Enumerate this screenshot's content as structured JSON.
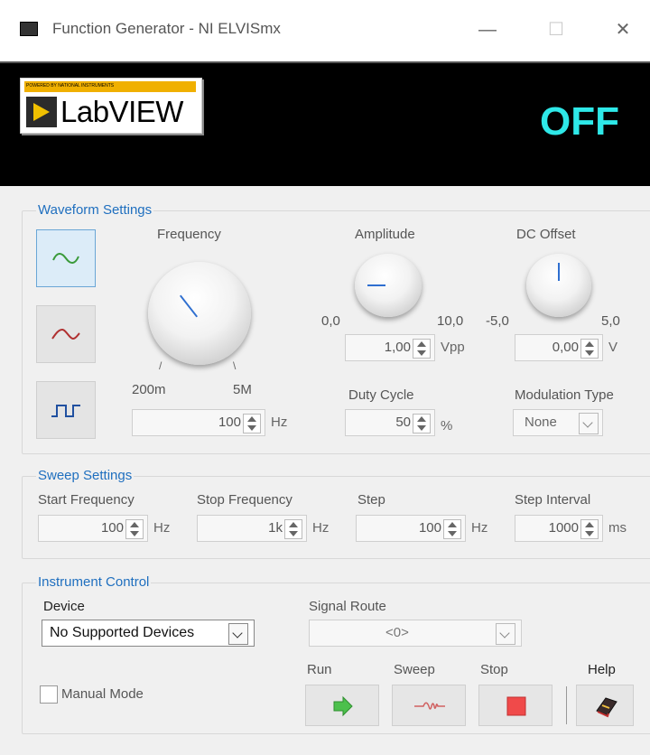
{
  "window": {
    "title": "Function Generator - NI ELVISmx",
    "minimize_glyph": "—",
    "maximize_glyph": "☐",
    "close_glyph": "✕"
  },
  "header": {
    "logo_text": "LabVIEW",
    "logo_strip_text": "POWERED BY NATIONAL INSTRUMENTS",
    "status": "OFF",
    "status_color": "#2ee8e8"
  },
  "waveform": {
    "title": "Waveform Settings",
    "waveforms": [
      {
        "icon": "sine-wave-icon",
        "color": "#3a9a3a",
        "selected": true
      },
      {
        "icon": "triangle-wave-icon",
        "color": "#b03030",
        "selected": false
      },
      {
        "icon": "square-wave-icon",
        "color": "#2050a0",
        "selected": false
      }
    ],
    "frequency": {
      "label": "Frequency",
      "min_label": "200m",
      "max_label": "5M",
      "value": "100",
      "unit": "Hz"
    },
    "amplitude": {
      "label": "Amplitude",
      "min_label": "0,0",
      "max_label": "10,0",
      "value": "1,00",
      "unit": "Vpp"
    },
    "dc_offset": {
      "label": "DC Offset",
      "min_label": "-5,0",
      "max_label": "5,0",
      "value": "0,00",
      "unit": "V"
    },
    "duty_cycle": {
      "label": "Duty Cycle",
      "value": "50",
      "unit": "%"
    },
    "modulation": {
      "label": "Modulation Type",
      "value": "None"
    }
  },
  "sweep": {
    "title": "Sweep Settings",
    "start": {
      "label": "Start Frequency",
      "value": "100",
      "unit": "Hz"
    },
    "stop": {
      "label": "Stop Frequency",
      "value": "1k",
      "unit": "Hz"
    },
    "step": {
      "label": "Step",
      "value": "100",
      "unit": "Hz"
    },
    "interval": {
      "label": "Step Interval",
      "value": "1000",
      "unit": "ms"
    }
  },
  "instrument": {
    "title": "Instrument Control",
    "device": {
      "label": "Device",
      "value": "No Supported Devices"
    },
    "signal_route": {
      "label": "Signal Route",
      "value": "<0>"
    },
    "manual_mode": {
      "label": "Manual Mode",
      "checked": false
    },
    "buttons": {
      "run": "Run",
      "sweep": "Sweep",
      "stop": "Stop",
      "help": "Help"
    }
  }
}
